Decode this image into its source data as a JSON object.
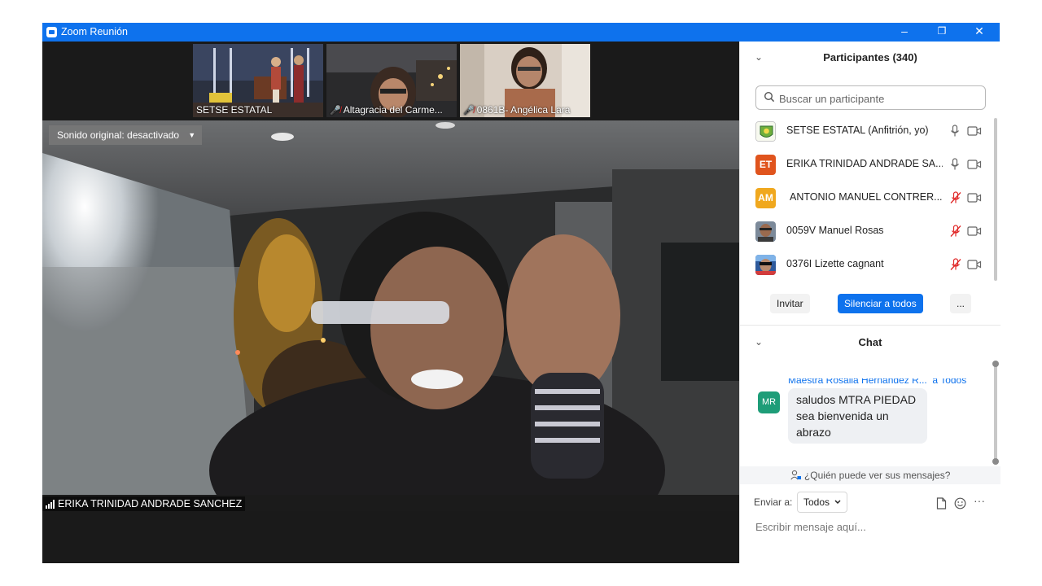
{
  "window": {
    "title": "Zoom Reunión",
    "controls": {
      "minimize": "–",
      "restore": "❐",
      "close": "✕"
    }
  },
  "thumbnails": [
    {
      "label": "SETSE ESTATAL",
      "muted": false
    },
    {
      "label": "Altagracia del Carme...",
      "muted": true
    },
    {
      "label": "0861B- Angélica Lara",
      "muted": true
    }
  ],
  "next_icon": "›",
  "main_video": {
    "sound_label": "Sonido original: desactivado",
    "sound_caret": "▼",
    "speaker_name": "ERIKA TRINIDAD ANDRADE SANCHEZ"
  },
  "participants": {
    "title": "Participantes (340)",
    "chevron": "⌄",
    "search_placeholder": "Buscar un participante",
    "items": [
      {
        "name": "SETSE ESTATAL (Anfitrión, yo)",
        "initials": "",
        "avatar_color": "#d7e7c3",
        "mic_muted": false
      },
      {
        "name": "ERIKA TRINIDAD ANDRADE SA...",
        "initials": "ET",
        "avatar_color": "#e0541d",
        "mic_muted": false
      },
      {
        "name": "ANTONIO MANUEL CONTRER...",
        "initials": "AM",
        "avatar_color": "#f0a81e",
        "mic_muted": true
      },
      {
        "name": "0059V Manuel Rosas",
        "initials": "",
        "avatar_color": "#8a6a55",
        "mic_muted": true
      },
      {
        "name": "0376I Lizette cagnant",
        "initials": "",
        "avatar_color": "#3d5f8f",
        "mic_muted": true
      }
    ],
    "buttons": {
      "invite": "Invitar",
      "mute_all": "Silenciar a todos",
      "more": "..."
    }
  },
  "chat": {
    "title": "Chat",
    "chevron": "⌄",
    "message": {
      "sender": "Maestra Rosalia Hernández R...",
      "to": "a Todos",
      "initials": "MR",
      "text": "saludos MTRA PIEDAD sea bienvenida un abrazo"
    },
    "who_can_see": "¿Quién puede ver sus mensajes?",
    "send_to_label": "Enviar a:",
    "send_to_value": "Todos",
    "more": "···",
    "input_placeholder": "Escribir mensaje aquí..."
  }
}
